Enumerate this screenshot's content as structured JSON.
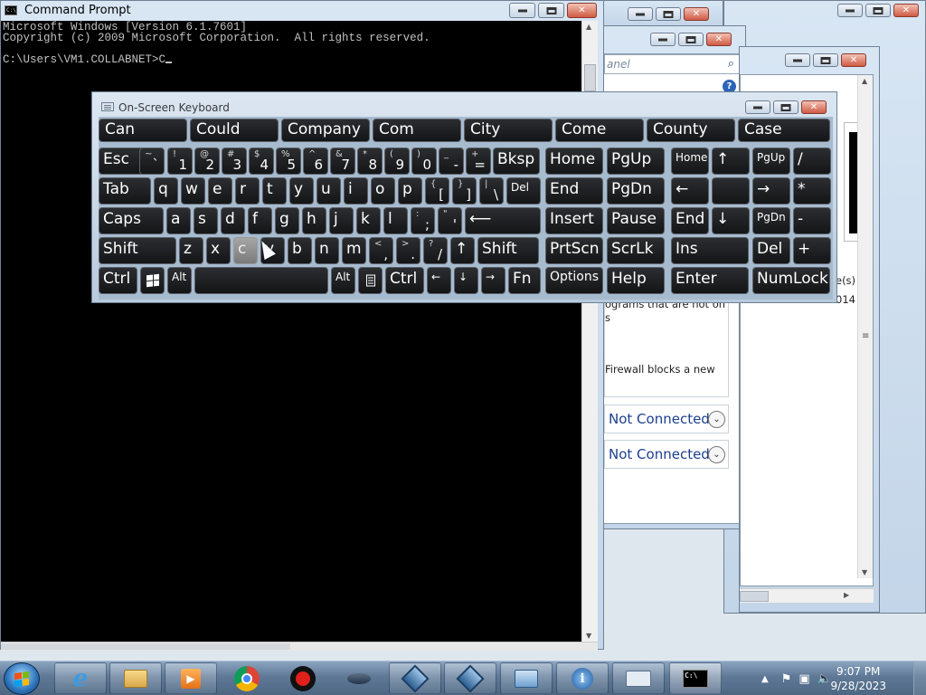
{
  "colors": {
    "console_bg": "#000000",
    "console_text": "#c0c0c0",
    "key_bg": "#1c1d20",
    "network_link": "#1d3f8e"
  },
  "cmd": {
    "title": "Command Prompt",
    "icon_text": "C:\\",
    "line1": "Microsoft Windows [Version 6.1.7601]",
    "line2": "Copyright (c) 2009 Microsoft Corporation.  All rights reserved.",
    "prompt": "C:\\Users\\VM1.COLLABNET>C"
  },
  "bg": {
    "search_placeholder": "anel",
    "text_programs_1": "ograms that are not on",
    "text_programs_2": "s",
    "text_firewall": "Firewall blocks a new",
    "text_right_1": "e(s)",
    "text_right_2": "014",
    "net_1": "Not Connected",
    "net_2": "Not Connected"
  },
  "osk": {
    "title": "On-Screen Keyboard",
    "predictions": [
      "Can",
      "Could",
      "Company",
      "Com",
      "City",
      "Come",
      "County",
      "Case"
    ],
    "row1": [
      {
        "m": "Esc"
      },
      {
        "t": "~",
        "b": "`"
      },
      {
        "t": "!",
        "b": "1"
      },
      {
        "t": "@",
        "b": "2"
      },
      {
        "t": "#",
        "b": "3"
      },
      {
        "t": "$",
        "b": "4"
      },
      {
        "t": "%",
        "b": "5"
      },
      {
        "t": "^",
        "b": "6"
      },
      {
        "t": "&",
        "b": "7"
      },
      {
        "t": "*",
        "b": "8"
      },
      {
        "t": "(",
        "b": "9"
      },
      {
        "t": ")",
        "b": "0"
      },
      {
        "t": "_",
        "b": "-"
      },
      {
        "t": "+",
        "b": "="
      },
      {
        "m": "Bksp"
      },
      {
        "m": "Home"
      },
      {
        "m": "PgUp"
      },
      {
        "s": "Home"
      },
      {
        "m": "↑"
      },
      {
        "s": "PgUp"
      },
      {
        "m": "/"
      }
    ],
    "row2": [
      {
        "m": "Tab"
      },
      {
        "m": "q"
      },
      {
        "m": "w"
      },
      {
        "m": "e"
      },
      {
        "m": "r"
      },
      {
        "m": "t"
      },
      {
        "m": "y"
      },
      {
        "m": "u"
      },
      {
        "m": "i"
      },
      {
        "m": "o"
      },
      {
        "m": "p"
      },
      {
        "t": "{",
        "b": "["
      },
      {
        "t": "}",
        "b": "]"
      },
      {
        "t": "|",
        "b": "\\"
      },
      {
        "s": "Del"
      },
      {
        "m": "End"
      },
      {
        "m": "PgDn"
      },
      {
        "m": "←"
      },
      {
        "m": ""
      },
      {
        "m": "→"
      },
      {
        "m": "*"
      }
    ],
    "row3": [
      {
        "m": "Caps"
      },
      {
        "m": "a"
      },
      {
        "m": "s"
      },
      {
        "m": "d"
      },
      {
        "m": "f"
      },
      {
        "m": "g"
      },
      {
        "m": "h"
      },
      {
        "m": "j"
      },
      {
        "m": "k"
      },
      {
        "m": "l"
      },
      {
        "t": ":",
        "b": ";"
      },
      {
        "t": "\"",
        "b": "'"
      },
      {
        "m": "⟵"
      },
      {
        "m": "Insert"
      },
      {
        "m": "Pause"
      },
      {
        "m": "End"
      },
      {
        "m": "↓"
      },
      {
        "s": "PgDn"
      },
      {
        "m": "-"
      }
    ],
    "row4": [
      {
        "m": "Shift"
      },
      {
        "m": "z"
      },
      {
        "m": "x"
      },
      {
        "m": "c"
      },
      {
        "m": "v"
      },
      {
        "m": "b"
      },
      {
        "m": "n"
      },
      {
        "m": "m"
      },
      {
        "t": "<",
        "b": ","
      },
      {
        "t": ">",
        "b": "."
      },
      {
        "t": "?",
        "b": "/"
      },
      {
        "m": "↑"
      },
      {
        "m": "Shift"
      },
      {
        "m": "PrtScn"
      },
      {
        "m": "ScrLk"
      },
      {
        "m": "Ins"
      },
      {
        "m": "Del"
      },
      {
        "m": "+"
      }
    ],
    "row5": [
      {
        "m": "Ctrl"
      },
      {
        "icon": "windows"
      },
      {
        "s": "Alt"
      },
      {
        "m": ""
      },
      {
        "s": "Alt"
      },
      {
        "icon": "menu"
      },
      {
        "m": "Ctrl"
      },
      {
        "s": "←"
      },
      {
        "s": "↓"
      },
      {
        "s": "→"
      },
      {
        "m": "Fn"
      },
      {
        "s2": "Options"
      },
      {
        "m": "Help"
      },
      {
        "m": "Enter"
      },
      {
        "m": "NumLock"
      }
    ]
  },
  "taskbar": {
    "time": "9:07 PM",
    "date": "9/28/2023",
    "cmd_icon_text": "C:\\",
    "items": [
      "internet-explorer",
      "windows-explorer",
      "media-player",
      "chrome",
      "record",
      "virtualbox",
      "vm-1",
      "vm-2",
      "network",
      "connect",
      "keyboard",
      "command-prompt"
    ]
  }
}
